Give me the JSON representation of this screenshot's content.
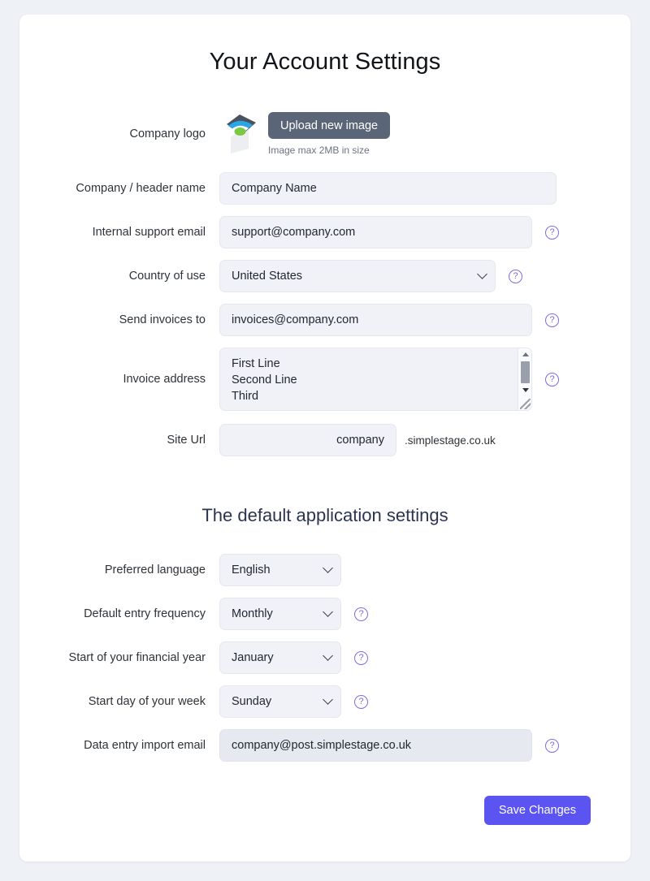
{
  "page": {
    "title": "Your Account Settings",
    "section_title": "The default application settings"
  },
  "logo_row": {
    "label": "Company logo",
    "upload_label": "Upload new image",
    "hint": "Image max 2MB in size",
    "logo_icon": "image-placeholder-logo",
    "upload_button_color": "#5b6578"
  },
  "fields": {
    "company_name": {
      "label": "Company / header name",
      "value": "Company Name"
    },
    "support_email": {
      "label": "Internal support email",
      "value": "support@company.com"
    },
    "country": {
      "label": "Country of use",
      "value": "United States",
      "options": [
        "United States"
      ]
    },
    "invoice_email": {
      "label": "Send invoices to",
      "value": "invoices@company.com"
    },
    "invoice_address": {
      "label": "Invoice address",
      "value": "First Line\nSecond Line\nThird"
    },
    "site_url": {
      "label": "Site Url",
      "value": "company",
      "suffix": ".simplestage.co.uk"
    },
    "language": {
      "label": "Preferred language",
      "value": "English",
      "options": [
        "English"
      ]
    },
    "entry_frequency": {
      "label": "Default entry frequency",
      "value": "Monthly",
      "options": [
        "Monthly"
      ]
    },
    "financial_year": {
      "label": "Start of your financial year",
      "value": "January",
      "options": [
        "January"
      ]
    },
    "week_start": {
      "label": "Start day of your week",
      "value": "Sunday",
      "options": [
        "Sunday"
      ]
    },
    "import_email": {
      "label": "Data entry import email",
      "value": "company@post.simplestage.co.uk"
    }
  },
  "help_icon_glyph": "?",
  "actions": {
    "save_label": "Save Changes",
    "save_color": "#5b54f0"
  }
}
